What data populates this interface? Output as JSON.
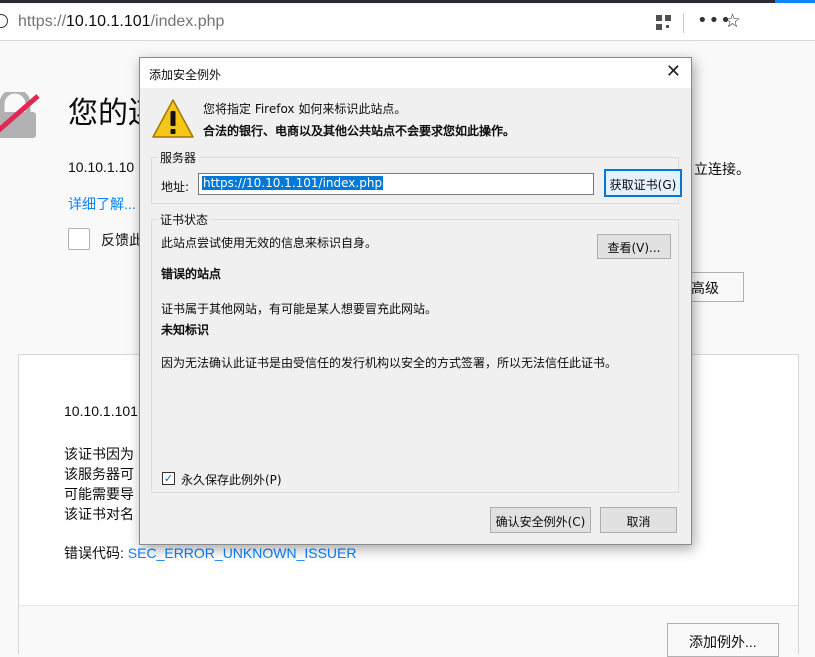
{
  "browser": {
    "url_prefix": "https://",
    "url_host": "10.10.1.101",
    "url_path": "/index.php"
  },
  "error_page": {
    "title": "您的连",
    "host_text": "10.10.1.10",
    "host_tail": "立连接。",
    "learn_more": "详细了解...",
    "report_label": "反馈此",
    "advanced_button": "高级",
    "advanced": {
      "host": "10.10.1.101",
      "lines": [
        "该证书因为",
        "该服务器可",
        "可能需要导",
        "该证书对名"
      ],
      "error_code_label": "错误代码: ",
      "error_code": "SEC_ERROR_UNKNOWN_ISSUER",
      "add_exception_button": "添加例外..."
    }
  },
  "dialog": {
    "title": "添加安全例外",
    "message": "您将指定 Firefox 如何来标识此站点。",
    "warning": "合法的银行、电商以及其他公共站点不会要求您如此操作。",
    "server_group": {
      "label": "服务器",
      "address_label": "地址:",
      "address_value": "https://10.10.1.101/index.php",
      "get_cert_button": "获取证书(G)"
    },
    "status_group": {
      "label": "证书状态",
      "intro": "此站点尝试使用无效的信息来标识自身。",
      "view_button": "查看(V)...",
      "wrong_site_heading": "错误的站点",
      "wrong_site_text": "证书属于其他网站，有可能是某人想要冒充此网站。",
      "unknown_heading": "未知标识",
      "unknown_text": "因为无法确认此证书是由受信任的发行机构以安全的方式签署，所以无法信任此证书。",
      "permanent_label": "永久保存此例外(P)",
      "permanent_checked": true
    },
    "confirm_button": "确认安全例外(C)",
    "cancel_button": "取消"
  }
}
